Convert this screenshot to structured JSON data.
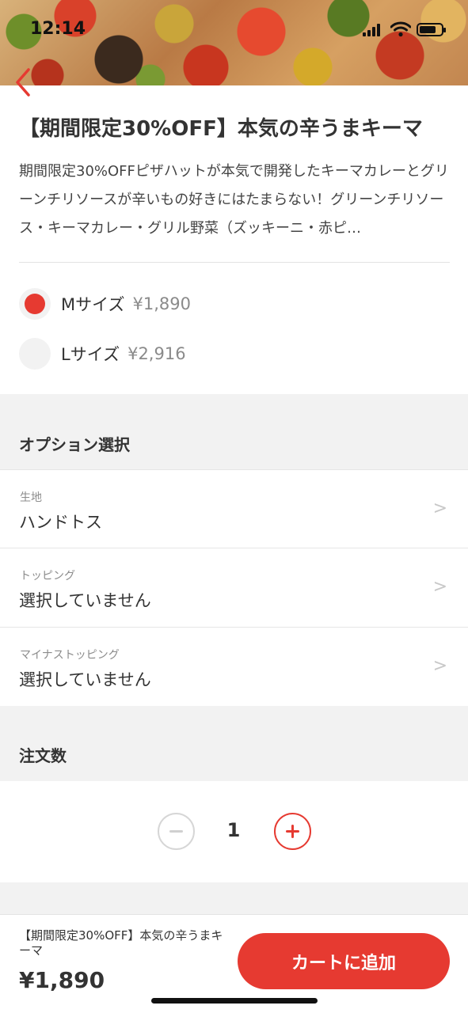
{
  "status_bar": {
    "time": "12:14"
  },
  "product": {
    "title": "【期間限定30%OFF】本気の辛うまキーマ",
    "description": "期間限定30%OFFピザハットが本気で開発したキーマカレーとグリーンチリソースが辛いもの好きにはたまらない！グリーンチリソース・キーマカレー・グリル野菜（ズッキーニ・赤ピ…"
  },
  "sizes": [
    {
      "name": "Mサイズ",
      "price": "¥1,890",
      "selected": true
    },
    {
      "name": "Lサイズ",
      "price": "¥2,916",
      "selected": false
    }
  ],
  "options_section": {
    "title": "オプション選択",
    "rows": [
      {
        "label": "生地",
        "value": "ハンドトス",
        "chevron": ">"
      },
      {
        "label": "トッピング",
        "value": "選択していません",
        "chevron": ">"
      },
      {
        "label": "マイナストッピング",
        "value": "選択していません",
        "chevron": ">"
      }
    ]
  },
  "quantity_section": {
    "title": "注文数",
    "value": "1"
  },
  "footer": {
    "product_name": "【期間限定30%OFF】本気の辛うまキーマ",
    "price": "¥1,890",
    "cart_button": "カートに追加"
  },
  "colors": {
    "accent": "#e63a31",
    "section_bg": "#f2f2f2",
    "muted_text": "#8c8c8c"
  }
}
